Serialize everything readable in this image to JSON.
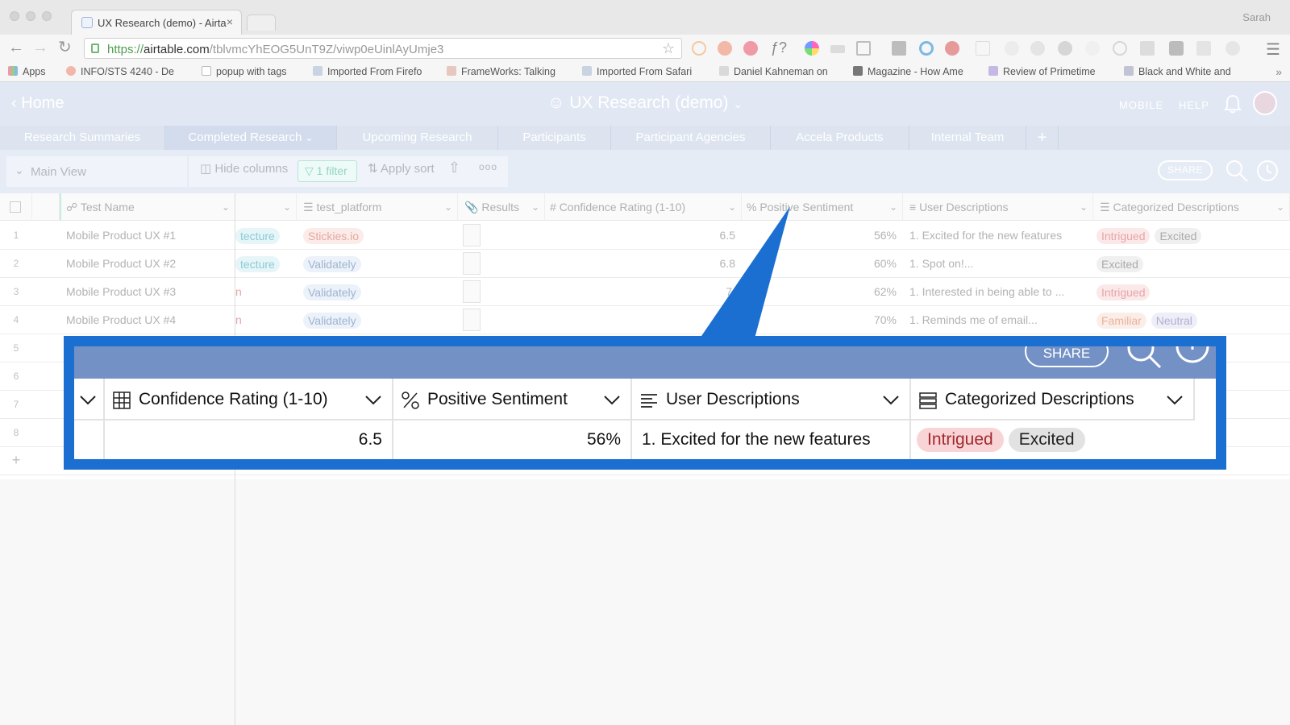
{
  "browser": {
    "tab_title": "UX Research (demo) - Airta",
    "tab_close": "×",
    "user": "Sarah",
    "url_scheme": "https://",
    "url_host": "airtable.com",
    "url_path": "/tblvmcYhEOG5UnT9Z/viwp0eUinlAyUmje3",
    "bookmarks": [
      "Apps",
      "INFO/STS 4240 - De",
      "popup with tags",
      "Imported From Firefo",
      "FrameWorks: Talking",
      "Imported From Safari",
      "Daniel Kahneman on",
      "Magazine - How Ame",
      "Review of Primetime",
      "Black and White and"
    ],
    "bookmarks_more": "»"
  },
  "app": {
    "home_label": "Home",
    "base_title": "UX Research (demo)",
    "mobile_label": "MOBILE",
    "help_label": "HELP",
    "tables": [
      "Research Summaries",
      "Completed Research",
      "Upcoming Research",
      "Participants",
      "Participant Agencies",
      "Accela Products",
      "Internal Team"
    ],
    "add_table": "+",
    "view": {
      "name": "Main View",
      "hide_columns": "Hide columns",
      "filter": "1 filter",
      "sort": "Apply sort",
      "more": "ooo",
      "share": "SHARE"
    },
    "columns": [
      "Test Name",
      "",
      "test_platform",
      "Results",
      "Confidence Rating (1-10)",
      "Positive Sentiment",
      "User Descriptions",
      "Categorized Descriptions"
    ],
    "rows": [
      {
        "num": "1",
        "name": "Mobile Product UX #1",
        "arch": "tecture",
        "platform": "Stickies.io",
        "confidence": "6.5",
        "sentiment": "56%",
        "desc": "1. Excited for the new features",
        "cats": [
          "Intrigued",
          "Excited"
        ]
      },
      {
        "num": "2",
        "name": "Mobile Product UX #2",
        "arch": "tecture",
        "platform": "Validately",
        "confidence": "6.8",
        "sentiment": "60%",
        "desc": "1. Spot on!...",
        "cats": [
          "Excited"
        ]
      },
      {
        "num": "3",
        "name": "Mobile Product UX #3",
        "arch": "n",
        "platform": "Validately",
        "confidence": "7.",
        "sentiment": "62%",
        "desc": "1. Interested in being able to ...",
        "cats": [
          "Intrigued"
        ]
      },
      {
        "num": "4",
        "name": "Mobile Product UX #4",
        "arch": "n",
        "platform": "Validately",
        "confidence": "",
        "sentiment": "70%",
        "desc": "1. Reminds me of email...",
        "cats": [
          "Familiar",
          "Neutral"
        ]
      }
    ],
    "empty_rows": [
      "5",
      "6",
      "7",
      "8"
    ],
    "add_row": "+"
  },
  "callout": {
    "share": "SHARE",
    "headers": [
      "Confidence Rating (1-10)",
      "Positive Sentiment",
      "User Descriptions",
      "Categorized Descriptions"
    ],
    "confidence": "6.5",
    "sentiment": "56%",
    "description": "1. Excited for the new features",
    "categories": [
      "Intrigued",
      "Excited"
    ]
  },
  "colors": {
    "header_bg": "#e2e8f3",
    "callout_blue": "#1b6fd0",
    "callout_bar": "#7491c6"
  }
}
